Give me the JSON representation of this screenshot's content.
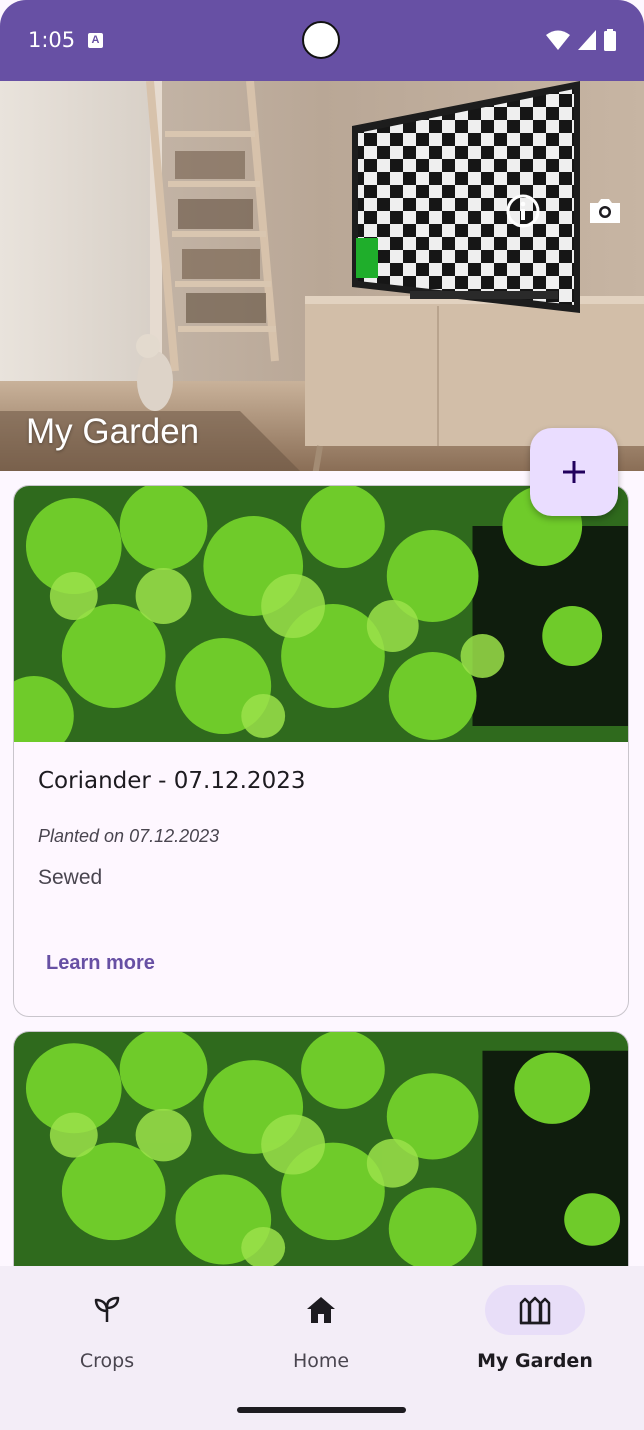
{
  "status_bar": {
    "time": "1:05",
    "notification_icon": "a-badge-icon",
    "icons": [
      "wifi-icon",
      "cellular-signal-icon",
      "battery-icon"
    ]
  },
  "header": {
    "title": "My Garden",
    "actions": [
      "info-icon",
      "camera-icon"
    ]
  },
  "fab": {
    "icon": "plus-icon"
  },
  "cards": [
    {
      "title": "Coriander - 07.12.2023",
      "planted": "Planted on 07.12.2023",
      "status": "Sewed",
      "action": "Learn more"
    }
  ],
  "bottom_nav": {
    "items": [
      {
        "label": "Crops",
        "icon": "sprout-icon"
      },
      {
        "label": "Home",
        "icon": "home-icon"
      },
      {
        "label": "My Garden",
        "icon": "garden-fence-icon",
        "active": true
      }
    ]
  },
  "colors": {
    "primary": "#6750a4",
    "fab_container": "#eaddff",
    "active_indicator": "#e8def8",
    "surface": "#fef7ff",
    "nav_background": "#f3edf7"
  }
}
